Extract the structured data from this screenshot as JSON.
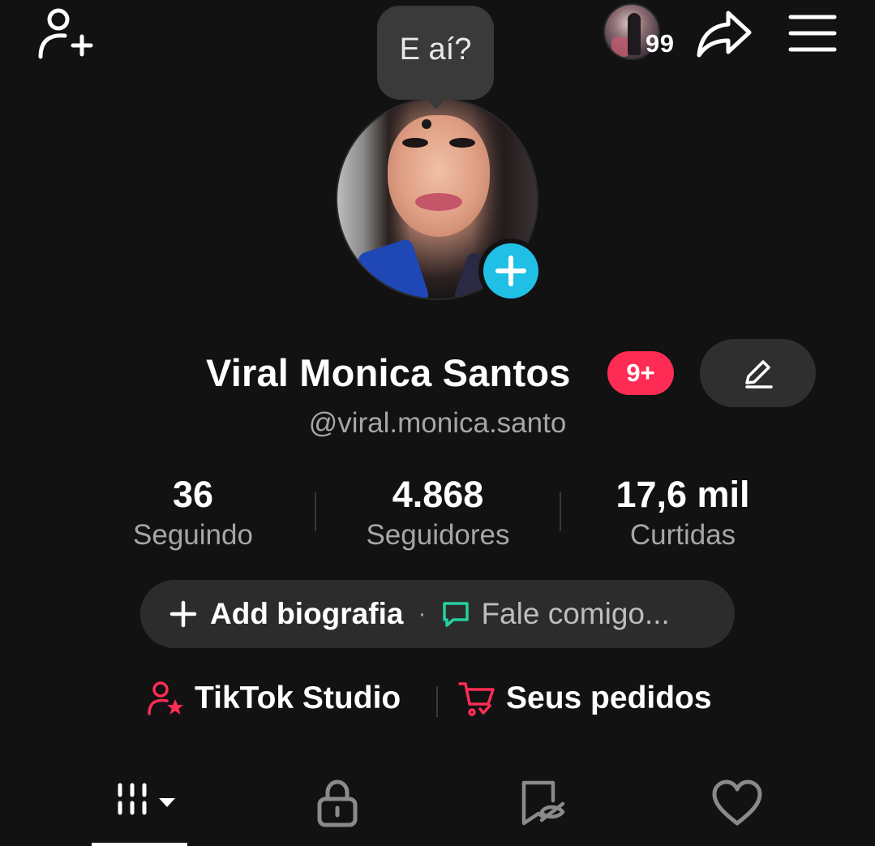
{
  "tooltip": {
    "text": "E aí?"
  },
  "story": {
    "count": "99"
  },
  "profile": {
    "display_name": "Viral Monica Santos",
    "notification_badge": "9+",
    "username": "@viral.monica.santo"
  },
  "stats": [
    {
      "value": "36",
      "label": "Seguindo"
    },
    {
      "value": "4.868",
      "label": "Seguidores"
    },
    {
      "value": "17,6 mil",
      "label": "Curtidas"
    }
  ],
  "bio": {
    "add_label": "Add biografia",
    "separator": "·",
    "chat_label": "Fale comigo..."
  },
  "links": {
    "studio_label": "TikTok Studio",
    "orders_label": "Seus pedidos"
  },
  "colors": {
    "background": "#121212",
    "accent_red": "#fe2c55",
    "accent_cyan": "#20bfe6",
    "accent_green": "#25d0a0"
  },
  "tabs": [
    {
      "icon": "grid-icon",
      "active": true
    },
    {
      "icon": "lock-icon",
      "active": false
    },
    {
      "icon": "hidden-bookmark-icon",
      "active": false
    },
    {
      "icon": "heart-icon",
      "active": false
    }
  ]
}
